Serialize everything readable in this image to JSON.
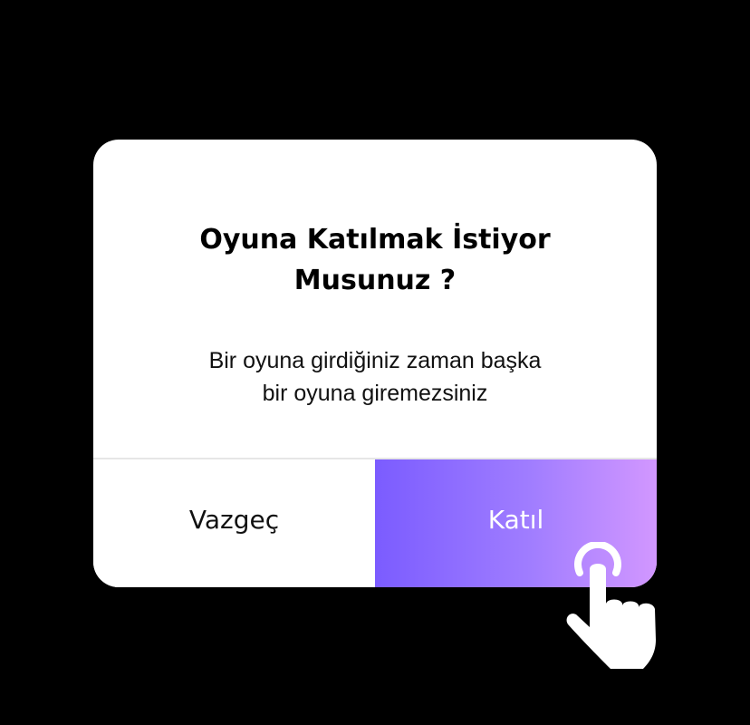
{
  "dialog": {
    "title_line1": "Oyuna Katılmak İstiyor",
    "title_line2": "Musunuz ?",
    "message_line1": "Bir oyuna girdiğiniz zaman başka",
    "message_line2": "bir oyuna giremezsiniz",
    "cancel_label": "Vazgeç",
    "join_label": "Katıl"
  },
  "colors": {
    "backdrop": "#000000",
    "dialog_background": "#ffffff",
    "join_gradient_start": "#7b5cff",
    "join_gradient_end": "#d297ff",
    "divider": "#e6e6e6"
  },
  "icons": {
    "pointer": "tap-hand-icon"
  }
}
